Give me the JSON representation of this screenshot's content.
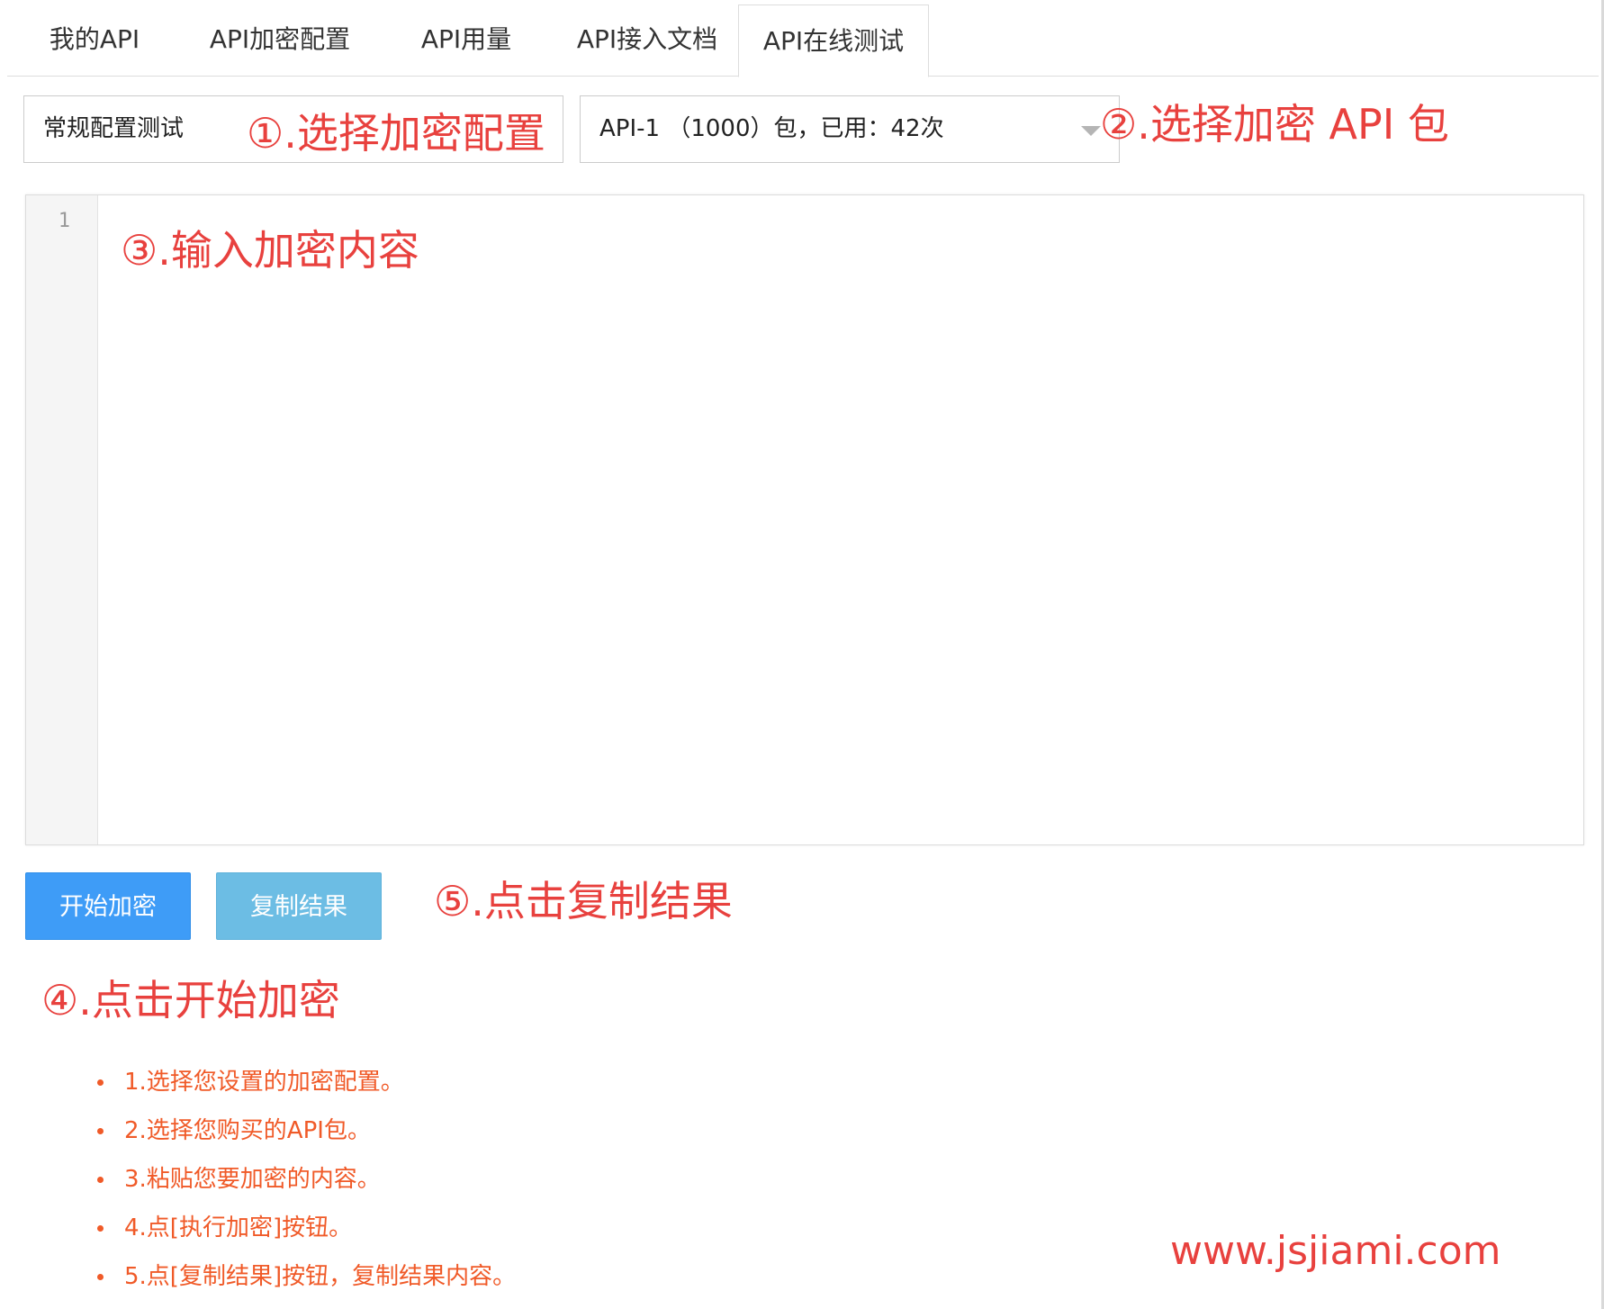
{
  "tabs": [
    {
      "label": "我的API"
    },
    {
      "label": "API加密配置"
    },
    {
      "label": "API用量"
    },
    {
      "label": "API接入文档"
    },
    {
      "label": "API在线测试",
      "active": true
    }
  ],
  "config_select": {
    "value": "常规配置测试"
  },
  "package_select": {
    "value": "API-1 （1000）包，已用：42次"
  },
  "editor": {
    "line_numbers": [
      "1"
    ],
    "content": ""
  },
  "buttons": {
    "encrypt": "开始加密",
    "copy": "复制结果"
  },
  "annotations": {
    "step1": "①.选择加密配置",
    "step2": "②.选择加密 API 包",
    "step3": "③.输入加密内容",
    "step4": "④.点击开始加密",
    "step5": "⑤.点击复制结果"
  },
  "instructions": [
    "1.选择您设置的加密配置。",
    "2.选择您购买的API包。",
    "3.粘贴您要加密的内容。",
    "4.点[执行加密]按钮。",
    "5.点[复制结果]按钮，复制结果内容。"
  ],
  "site_url": "www.jsjiami.com",
  "colors": {
    "annotation": "#e8413e",
    "instruction": "#f05a28",
    "primary_button": "#3e9cf7",
    "info_button": "#6cbde4"
  }
}
